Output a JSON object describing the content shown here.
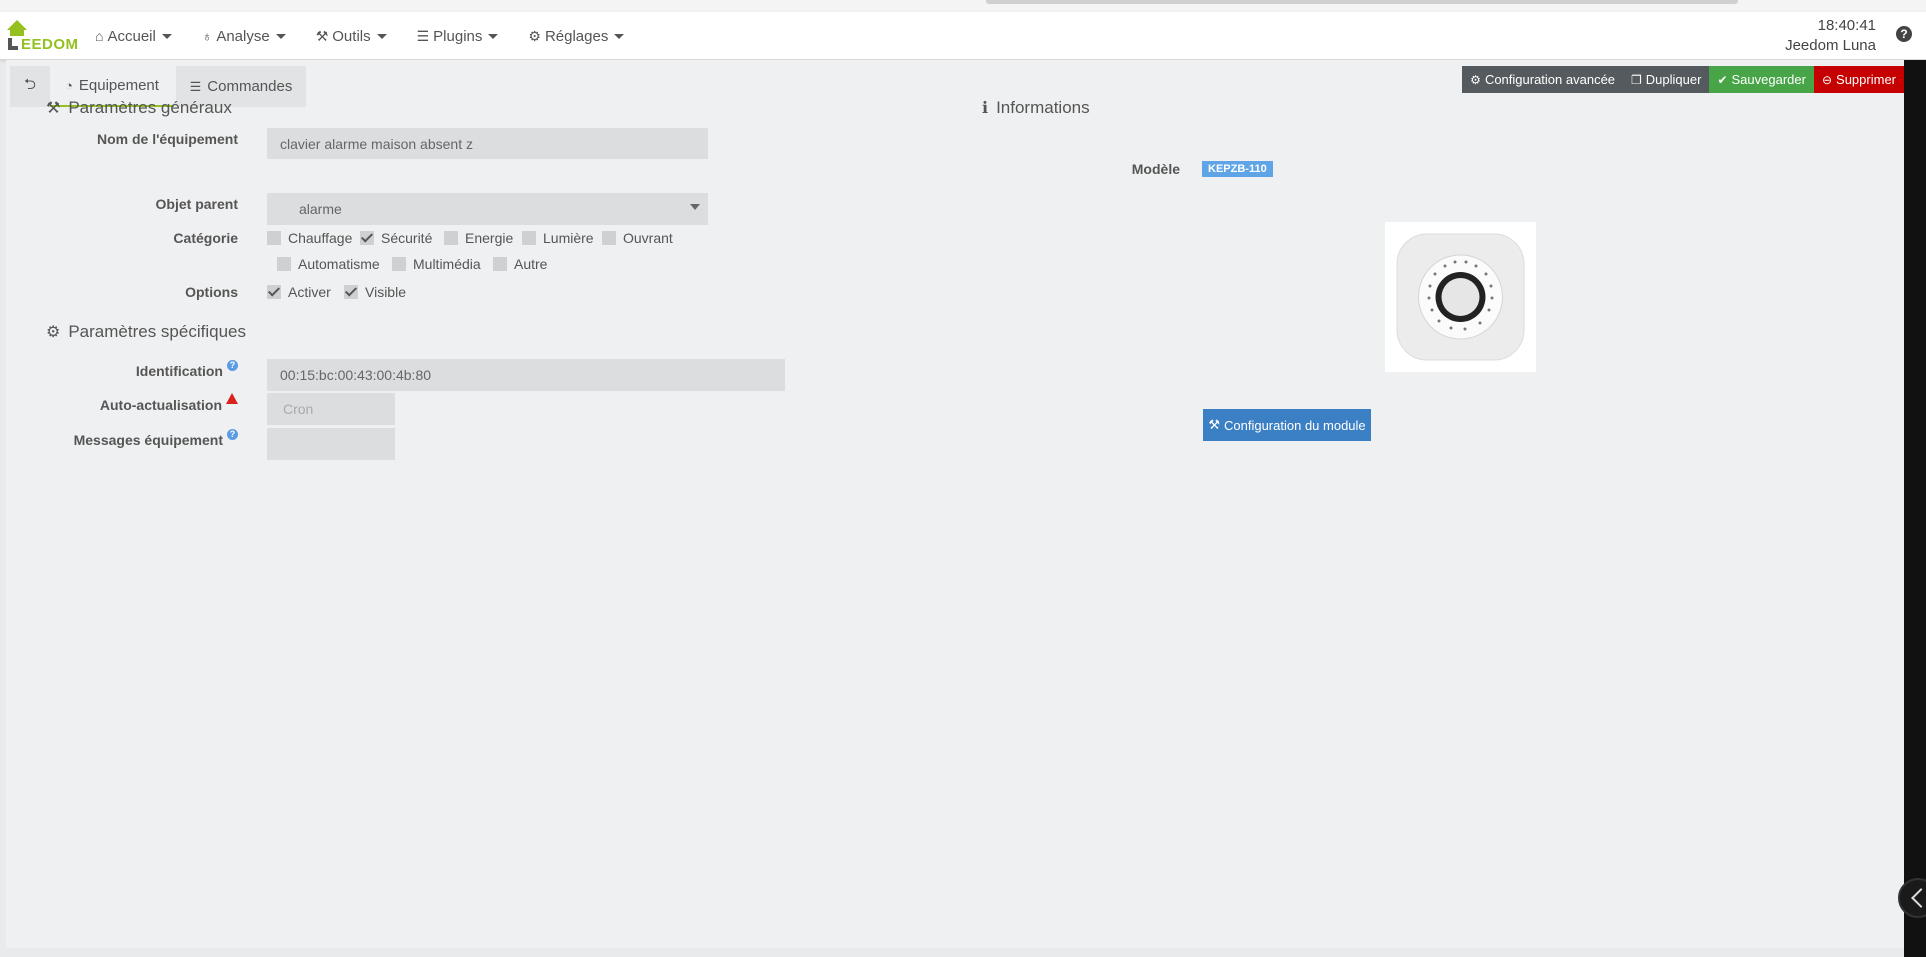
{
  "colors": {
    "brand": "#94c11f",
    "accent": "#5ea4e6",
    "primary_button": "#3b7fc4",
    "success": "#47a447",
    "danger": "#c60000",
    "warning_icon": "#d9231e"
  },
  "app": {
    "logo_text": "EEDOM"
  },
  "nav": {
    "items": [
      {
        "label": "Accueil",
        "icon": "home-icon"
      },
      {
        "label": "Analyse",
        "icon": "stethoscope-icon"
      },
      {
        "label": "Outils",
        "icon": "wrench-icon"
      },
      {
        "label": "Plugins",
        "icon": "tasks-icon"
      },
      {
        "label": "Réglages",
        "icon": "gear-icon"
      }
    ],
    "time": "18:40:41",
    "user": "Jeedom Luna",
    "help_label": "?"
  },
  "tabs": {
    "equipement": "Equipement",
    "commandes": "Commandes"
  },
  "actions": {
    "advanced": "Configuration avancée",
    "duplicate": "Dupliquer",
    "save": "Sauvegarder",
    "delete": "Supprimer"
  },
  "general": {
    "title": "Paramètres généraux",
    "name_label": "Nom de l'équipement",
    "name_value": "clavier alarme maison absent z",
    "parent_label": "Objet parent",
    "parent_value": "alarme",
    "category_label": "Catégorie",
    "categories": [
      {
        "label": "Chauffage",
        "checked": false
      },
      {
        "label": "Sécurité",
        "checked": true
      },
      {
        "label": "Energie",
        "checked": false
      },
      {
        "label": "Lumière",
        "checked": false
      },
      {
        "label": "Ouvrant",
        "checked": false
      },
      {
        "label": "Automatisme",
        "checked": false
      },
      {
        "label": "Multimédia",
        "checked": false
      },
      {
        "label": "Autre",
        "checked": false
      }
    ],
    "options_label": "Options",
    "options": [
      {
        "label": "Activer",
        "checked": true
      },
      {
        "label": "Visible",
        "checked": true
      }
    ]
  },
  "specific": {
    "title": "Paramètres spécifiques",
    "identification_label": "Identification",
    "identification_value": "00:15:bc:00:43:00:4b:80",
    "autorefresh_label": "Auto-actualisation",
    "autorefresh_placeholder": "Cron",
    "messages_label": "Messages équipement",
    "messages_value": ""
  },
  "info": {
    "title": "Informations",
    "model_label": "Modèle",
    "model_value": "KEPZB-110",
    "config_button": "Configuration du module"
  }
}
